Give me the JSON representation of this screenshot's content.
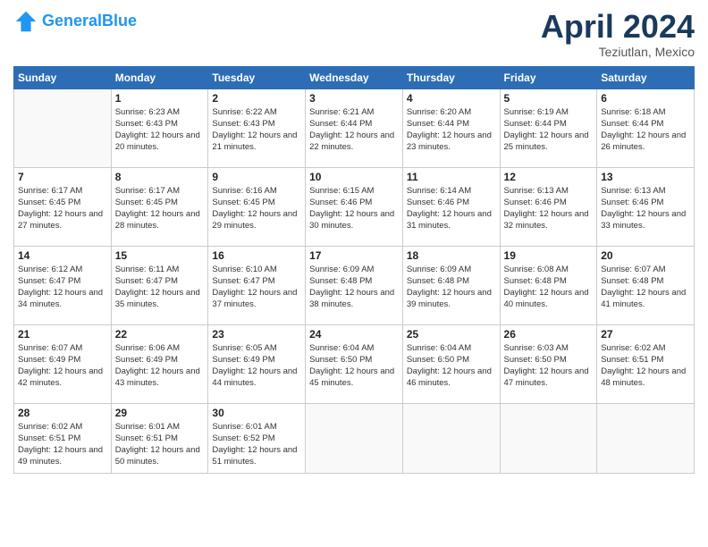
{
  "header": {
    "logo_line1": "General",
    "logo_line2": "Blue",
    "month": "April 2024",
    "location": "Teziutlan, Mexico"
  },
  "days_of_week": [
    "Sunday",
    "Monday",
    "Tuesday",
    "Wednesday",
    "Thursday",
    "Friday",
    "Saturday"
  ],
  "weeks": [
    [
      {
        "day": "",
        "sunrise": "",
        "sunset": "",
        "daylight": ""
      },
      {
        "day": "1",
        "sunrise": "Sunrise: 6:23 AM",
        "sunset": "Sunset: 6:43 PM",
        "daylight": "Daylight: 12 hours and 20 minutes."
      },
      {
        "day": "2",
        "sunrise": "Sunrise: 6:22 AM",
        "sunset": "Sunset: 6:43 PM",
        "daylight": "Daylight: 12 hours and 21 minutes."
      },
      {
        "day": "3",
        "sunrise": "Sunrise: 6:21 AM",
        "sunset": "Sunset: 6:44 PM",
        "daylight": "Daylight: 12 hours and 22 minutes."
      },
      {
        "day": "4",
        "sunrise": "Sunrise: 6:20 AM",
        "sunset": "Sunset: 6:44 PM",
        "daylight": "Daylight: 12 hours and 23 minutes."
      },
      {
        "day": "5",
        "sunrise": "Sunrise: 6:19 AM",
        "sunset": "Sunset: 6:44 PM",
        "daylight": "Daylight: 12 hours and 25 minutes."
      },
      {
        "day": "6",
        "sunrise": "Sunrise: 6:18 AM",
        "sunset": "Sunset: 6:44 PM",
        "daylight": "Daylight: 12 hours and 26 minutes."
      }
    ],
    [
      {
        "day": "7",
        "sunrise": "Sunrise: 6:17 AM",
        "sunset": "Sunset: 6:45 PM",
        "daylight": "Daylight: 12 hours and 27 minutes."
      },
      {
        "day": "8",
        "sunrise": "Sunrise: 6:17 AM",
        "sunset": "Sunset: 6:45 PM",
        "daylight": "Daylight: 12 hours and 28 minutes."
      },
      {
        "day": "9",
        "sunrise": "Sunrise: 6:16 AM",
        "sunset": "Sunset: 6:45 PM",
        "daylight": "Daylight: 12 hours and 29 minutes."
      },
      {
        "day": "10",
        "sunrise": "Sunrise: 6:15 AM",
        "sunset": "Sunset: 6:46 PM",
        "daylight": "Daylight: 12 hours and 30 minutes."
      },
      {
        "day": "11",
        "sunrise": "Sunrise: 6:14 AM",
        "sunset": "Sunset: 6:46 PM",
        "daylight": "Daylight: 12 hours and 31 minutes."
      },
      {
        "day": "12",
        "sunrise": "Sunrise: 6:13 AM",
        "sunset": "Sunset: 6:46 PM",
        "daylight": "Daylight: 12 hours and 32 minutes."
      },
      {
        "day": "13",
        "sunrise": "Sunrise: 6:13 AM",
        "sunset": "Sunset: 6:46 PM",
        "daylight": "Daylight: 12 hours and 33 minutes."
      }
    ],
    [
      {
        "day": "14",
        "sunrise": "Sunrise: 6:12 AM",
        "sunset": "Sunset: 6:47 PM",
        "daylight": "Daylight: 12 hours and 34 minutes."
      },
      {
        "day": "15",
        "sunrise": "Sunrise: 6:11 AM",
        "sunset": "Sunset: 6:47 PM",
        "daylight": "Daylight: 12 hours and 35 minutes."
      },
      {
        "day": "16",
        "sunrise": "Sunrise: 6:10 AM",
        "sunset": "Sunset: 6:47 PM",
        "daylight": "Daylight: 12 hours and 37 minutes."
      },
      {
        "day": "17",
        "sunrise": "Sunrise: 6:09 AM",
        "sunset": "Sunset: 6:48 PM",
        "daylight": "Daylight: 12 hours and 38 minutes."
      },
      {
        "day": "18",
        "sunrise": "Sunrise: 6:09 AM",
        "sunset": "Sunset: 6:48 PM",
        "daylight": "Daylight: 12 hours and 39 minutes."
      },
      {
        "day": "19",
        "sunrise": "Sunrise: 6:08 AM",
        "sunset": "Sunset: 6:48 PM",
        "daylight": "Daylight: 12 hours and 40 minutes."
      },
      {
        "day": "20",
        "sunrise": "Sunrise: 6:07 AM",
        "sunset": "Sunset: 6:48 PM",
        "daylight": "Daylight: 12 hours and 41 minutes."
      }
    ],
    [
      {
        "day": "21",
        "sunrise": "Sunrise: 6:07 AM",
        "sunset": "Sunset: 6:49 PM",
        "daylight": "Daylight: 12 hours and 42 minutes."
      },
      {
        "day": "22",
        "sunrise": "Sunrise: 6:06 AM",
        "sunset": "Sunset: 6:49 PM",
        "daylight": "Daylight: 12 hours and 43 minutes."
      },
      {
        "day": "23",
        "sunrise": "Sunrise: 6:05 AM",
        "sunset": "Sunset: 6:49 PM",
        "daylight": "Daylight: 12 hours and 44 minutes."
      },
      {
        "day": "24",
        "sunrise": "Sunrise: 6:04 AM",
        "sunset": "Sunset: 6:50 PM",
        "daylight": "Daylight: 12 hours and 45 minutes."
      },
      {
        "day": "25",
        "sunrise": "Sunrise: 6:04 AM",
        "sunset": "Sunset: 6:50 PM",
        "daylight": "Daylight: 12 hours and 46 minutes."
      },
      {
        "day": "26",
        "sunrise": "Sunrise: 6:03 AM",
        "sunset": "Sunset: 6:50 PM",
        "daylight": "Daylight: 12 hours and 47 minutes."
      },
      {
        "day": "27",
        "sunrise": "Sunrise: 6:02 AM",
        "sunset": "Sunset: 6:51 PM",
        "daylight": "Daylight: 12 hours and 48 minutes."
      }
    ],
    [
      {
        "day": "28",
        "sunrise": "Sunrise: 6:02 AM",
        "sunset": "Sunset: 6:51 PM",
        "daylight": "Daylight: 12 hours and 49 minutes."
      },
      {
        "day": "29",
        "sunrise": "Sunrise: 6:01 AM",
        "sunset": "Sunset: 6:51 PM",
        "daylight": "Daylight: 12 hours and 50 minutes."
      },
      {
        "day": "30",
        "sunrise": "Sunrise: 6:01 AM",
        "sunset": "Sunset: 6:52 PM",
        "daylight": "Daylight: 12 hours and 51 minutes."
      },
      {
        "day": "",
        "sunrise": "",
        "sunset": "",
        "daylight": ""
      },
      {
        "day": "",
        "sunrise": "",
        "sunset": "",
        "daylight": ""
      },
      {
        "day": "",
        "sunrise": "",
        "sunset": "",
        "daylight": ""
      },
      {
        "day": "",
        "sunrise": "",
        "sunset": "",
        "daylight": ""
      }
    ]
  ]
}
